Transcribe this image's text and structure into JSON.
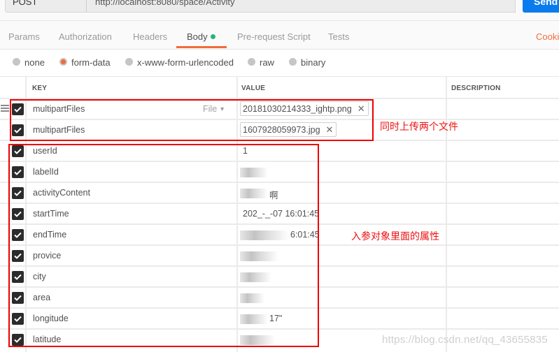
{
  "request": {
    "method": "POST",
    "url": "http://localhost:8080/space/Activity",
    "send_label": "Send"
  },
  "tabs": [
    {
      "label": "Params",
      "active": false
    },
    {
      "label": "Authorization",
      "active": false
    },
    {
      "label": "Headers",
      "active": false
    },
    {
      "label": "Body",
      "active": true,
      "indicator_color": "#26b47f"
    },
    {
      "label": "Pre-request Script",
      "active": false
    },
    {
      "label": "Tests",
      "active": false
    }
  ],
  "cookies_label": "Cookies",
  "accent_color": "#f26b3a",
  "body_types": [
    {
      "label": "none",
      "selected": false
    },
    {
      "label": "form-data",
      "selected": true
    },
    {
      "label": "x-www-form-urlencoded",
      "selected": false
    },
    {
      "label": "raw",
      "selected": false
    },
    {
      "label": "binary",
      "selected": false
    }
  ],
  "table": {
    "headers": {
      "key": "KEY",
      "value": "VALUE",
      "description": "DESCRIPTION"
    },
    "rows": [
      {
        "checked": true,
        "key": "multipartFiles",
        "type": "File",
        "value": "20181030214333_ightp.png",
        "is_file": true
      },
      {
        "checked": true,
        "key": "multipartFiles",
        "value": "1607928059973.jpg",
        "is_file": true
      },
      {
        "checked": true,
        "key": "userId",
        "value": "1"
      },
      {
        "checked": true,
        "key": "labelId",
        "value": ""
      },
      {
        "checked": true,
        "key": "activityContent",
        "value": "啊"
      },
      {
        "checked": true,
        "key": "startTime",
        "value": "202_-_-07 16:01:45"
      },
      {
        "checked": true,
        "key": "endTime",
        "value": "6:01:45"
      },
      {
        "checked": true,
        "key": "provice",
        "value": ""
      },
      {
        "checked": true,
        "key": "city",
        "value": ""
      },
      {
        "checked": true,
        "key": "area",
        "value": ""
      },
      {
        "checked": true,
        "key": "longitude",
        "value": "17\""
      },
      {
        "checked": true,
        "key": "latitude",
        "value": ""
      }
    ]
  },
  "annotations": {
    "files_note": "同时上传两个文件",
    "params_note": "入参对象里面的属性",
    "color": "#ee0000"
  },
  "watermark": "https://blog.csdn.net/qq_43655835"
}
